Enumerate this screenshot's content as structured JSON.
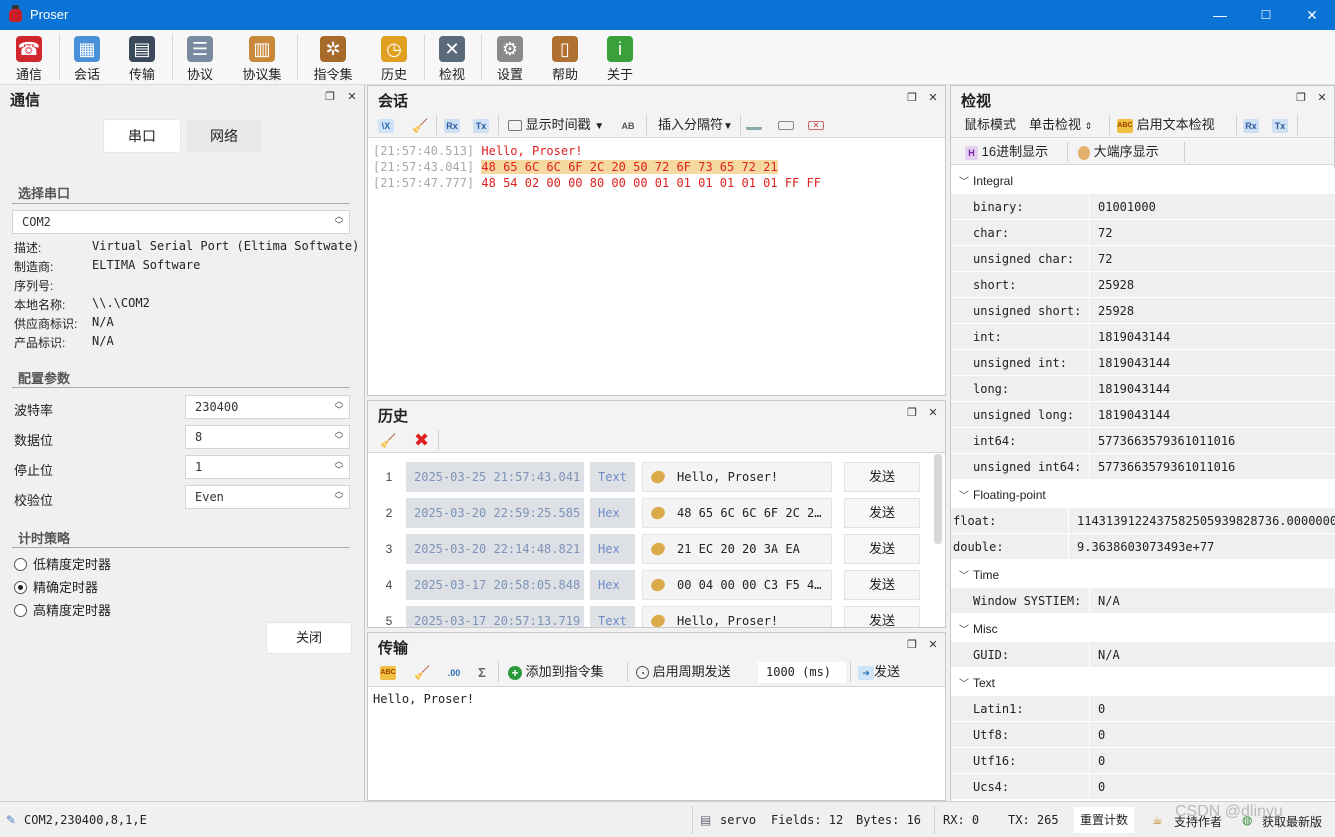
{
  "window": {
    "title": "Proser",
    "min": "—",
    "max": "☐",
    "close": "✕"
  },
  "toolbar": [
    {
      "label": "通信",
      "icon": "phone-icon",
      "color": "#d0262c"
    },
    {
      "label": "会话",
      "icon": "session-icon",
      "color": "#4a90d9"
    },
    {
      "label": "传输",
      "icon": "terminal-icon",
      "color": "#3a4a5a"
    },
    {
      "label": "协议",
      "icon": "protocol-icon",
      "color": "#7a8aa0"
    },
    {
      "label": "协议集",
      "icon": "protocol-set-icon",
      "color": "#c88a3a"
    },
    {
      "label": "指令集",
      "icon": "helm-icon",
      "color": "#a86a2a"
    },
    {
      "label": "历史",
      "icon": "clock-icon",
      "color": "#e0a020"
    },
    {
      "label": "检视",
      "icon": "tools-icon",
      "color": "#5a6a7a"
    },
    {
      "label": "设置",
      "icon": "gear-icon",
      "color": "#8a8a8a"
    },
    {
      "label": "帮助",
      "icon": "book-icon",
      "color": "#b07030"
    },
    {
      "label": "关于",
      "icon": "info-icon",
      "color": "#3aa03a"
    }
  ],
  "left": {
    "title": "通信",
    "tab_serial": "串口",
    "tab_network": "网络",
    "section_port": "选择串口",
    "port": "COM2",
    "info": [
      {
        "k": "描述:",
        "v": "Virtual Serial Port (Eltima Softwate)"
      },
      {
        "k": "制造商:",
        "v": "ELTIMA Software"
      },
      {
        "k": "序列号:",
        "v": ""
      },
      {
        "k": "本地名称:",
        "v": "\\\\.\\COM2"
      },
      {
        "k": "供应商标识:",
        "v": "N/A"
      },
      {
        "k": "产品标识:",
        "v": "N/A"
      }
    ],
    "section_config": "配置参数",
    "params": [
      {
        "k": "波特率",
        "v": "230400"
      },
      {
        "k": "数据位",
        "v": "8"
      },
      {
        "k": "停止位",
        "v": "1"
      },
      {
        "k": "校验位",
        "v": "Even"
      }
    ],
    "section_timer": "计时策略",
    "timers": [
      {
        "label": "低精度定时器",
        "checked": false
      },
      {
        "label": "精确定时器",
        "checked": true
      },
      {
        "label": "高精度定时器",
        "checked": false
      }
    ],
    "close_button": "关闭"
  },
  "session": {
    "title": "会话",
    "show_timestamp": "显示时间戳",
    "insert_separator": "插入分隔符",
    "lines": [
      {
        "ts": "[21:57:40.513]",
        "text": "Hello, Proser!",
        "highlight": false
      },
      {
        "ts": "[21:57:43.041]",
        "text": "48 65 6C 6C 6F 2C 20 50 72 6F 73 65 72 21",
        "highlight": true
      },
      {
        "ts": "[21:57:47.777]",
        "text": "48 54 02 00 00 80 00 00 01 01 01 01 01 01 FF FF",
        "highlight": false
      }
    ]
  },
  "history": {
    "title": "历史",
    "rows": [
      {
        "idx": "1",
        "time": "2025-03-25 21:57:43.041",
        "fmt": "Text",
        "content": "Hello, Proser!",
        "send": "发送"
      },
      {
        "idx": "2",
        "time": "2025-03-20 22:59:25.585",
        "fmt": "Hex",
        "content": "48 65 6C 6C 6F 2C 2…",
        "send": "发送"
      },
      {
        "idx": "3",
        "time": "2025-03-20 22:14:48.821",
        "fmt": "Hex",
        "content": "21 EC 20 20 3A EA",
        "send": "发送"
      },
      {
        "idx": "4",
        "time": "2025-03-17 20:58:05.848",
        "fmt": "Hex",
        "content": "00 04 00 00 C3 F5 4…",
        "send": "发送"
      },
      {
        "idx": "5",
        "time": "2025-03-17 20:57:13.719",
        "fmt": "Text",
        "content": "Hello, Proser!",
        "send": "发送"
      }
    ]
  },
  "transfer": {
    "title": "传输",
    "add_to_set": "添加到指令集",
    "periodic": "启用周期发送",
    "period": "1000 (ms)",
    "send": "发送",
    "input": "Hello, Proser!"
  },
  "inspector": {
    "title": "检视",
    "mouse_mode": "鼠标模式",
    "click_mode": "单击检视",
    "text_inspect": "启用文本检视",
    "hex_display": "16进制显示",
    "big_endian": "大端序显示",
    "integral": "Integral",
    "integral_rows": [
      {
        "k": "binary:",
        "v": "01001000"
      },
      {
        "k": "char:",
        "v": "72"
      },
      {
        "k": "unsigned char:",
        "v": "72"
      },
      {
        "k": "short:",
        "v": "25928"
      },
      {
        "k": "unsigned short:",
        "v": "25928"
      },
      {
        "k": "int:",
        "v": "1819043144"
      },
      {
        "k": "unsigned int:",
        "v": "1819043144"
      },
      {
        "k": "long:",
        "v": "1819043144"
      },
      {
        "k": "unsigned long:",
        "v": "1819043144"
      },
      {
        "k": "int64:",
        "v": "5773663579361011016"
      },
      {
        "k": "unsigned int64:",
        "v": "5773663579361011016"
      }
    ],
    "floating": "Floating-point",
    "float_rows": [
      {
        "k": "float:",
        "v": "1143139122437582505939828736.0000000"
      },
      {
        "k": "double:",
        "v": "9.3638603073493e+77"
      }
    ],
    "time": "Time",
    "time_rows": [
      {
        "k": "Window SYSTIEM:",
        "v": "N/A"
      }
    ],
    "misc": "Misc",
    "misc_rows": [
      {
        "k": "GUID:",
        "v": "N/A"
      }
    ],
    "text": "Text",
    "text_rows": [
      {
        "k": "Latin1:",
        "v": "0"
      },
      {
        "k": "Utf8:",
        "v": "0"
      },
      {
        "k": "Utf16:",
        "v": "0"
      },
      {
        "k": "Ucs4:",
        "v": "0"
      }
    ]
  },
  "status": {
    "port_info": "COM2,230400,8,1,E",
    "protocol": "servo",
    "fields": "Fields: 12",
    "bytes": "Bytes: 16",
    "rx": "RX: 0",
    "tx": "TX: 265",
    "reset": "重置计数",
    "support": "支持作者",
    "update": "获取最新版",
    "watermark": "CSDN @dlinyu"
  },
  "colors": {
    "accent": "#0a74d6",
    "error_red": "#e02020",
    "highlight": "#f6d9a0"
  }
}
